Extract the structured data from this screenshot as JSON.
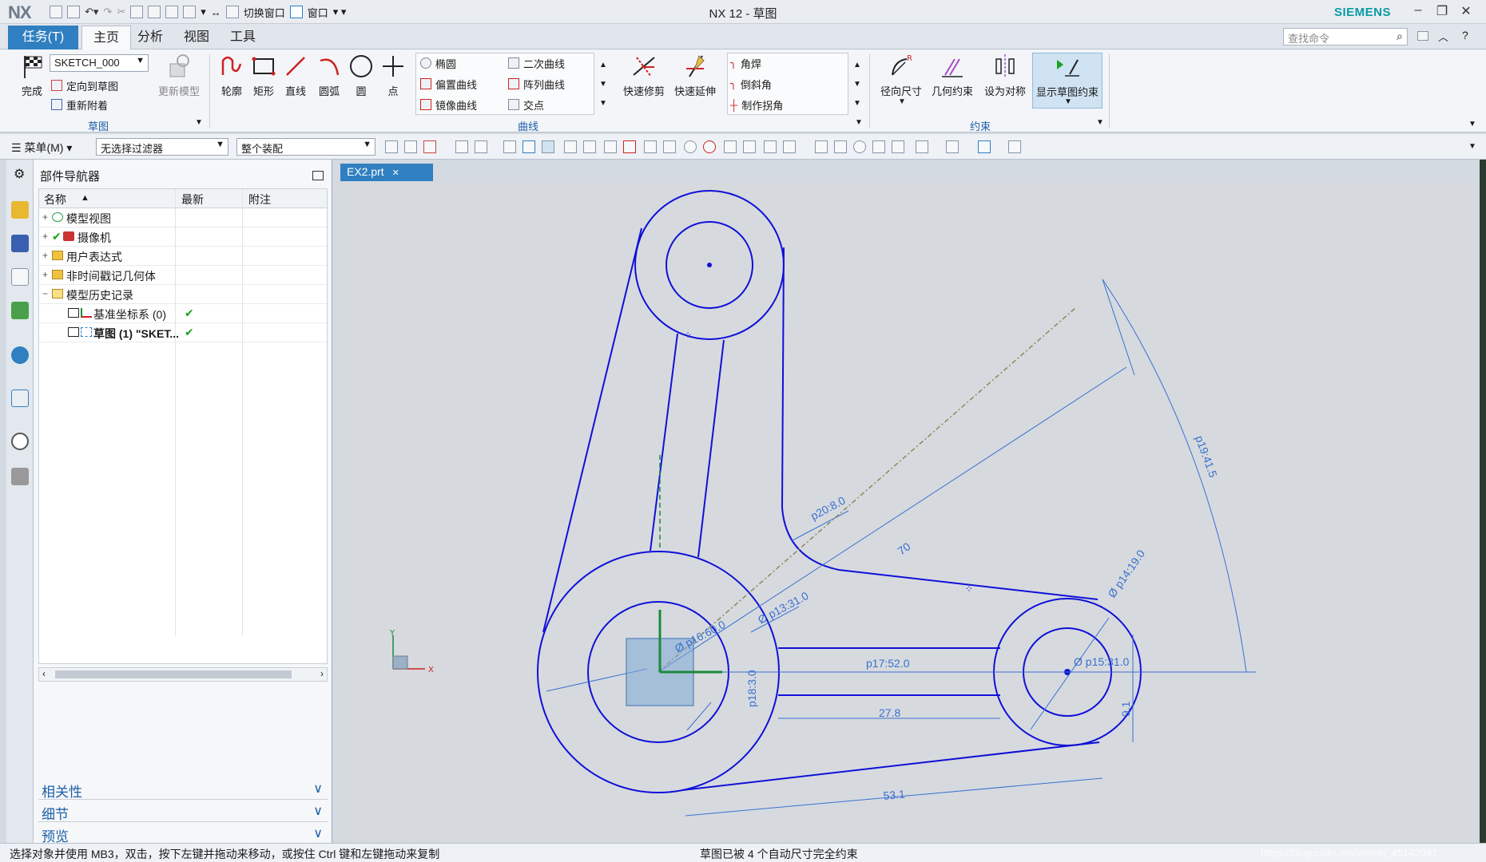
{
  "app": {
    "logo": "NX",
    "title": "NX 12 - 草图",
    "brand": "SIEMENS"
  },
  "quick_access": {
    "switch_window": "切换窗口",
    "window": "窗口"
  },
  "tabs": [
    {
      "label": "任务(T)"
    },
    {
      "label": "主页"
    },
    {
      "label": "分析"
    },
    {
      "label": "视图"
    },
    {
      "label": "工具"
    }
  ],
  "search": {
    "placeholder": "查找命令"
  },
  "ribbon": {
    "sketch": {
      "finish": "完成",
      "sketch_name": "SKETCH_000",
      "orient": "定向到草图",
      "reattach": "重新附着",
      "update_model": "更新模型",
      "group": "草图"
    },
    "curve": {
      "profile": "轮廓",
      "rect": "矩形",
      "line": "直线",
      "arc": "圆弧",
      "circle": "圆",
      "point": "点",
      "ellipse": "椭圆",
      "conic": "二次曲线",
      "offset": "偏置曲线",
      "pattern": "阵列曲线",
      "mirror": "镜像曲线",
      "intersect": "交点",
      "quick_trim": "快速修剪",
      "quick_extend": "快速延伸",
      "fillet": "角焊",
      "chamfer": "倒斜角",
      "make_corner": "制作拐角",
      "group": "曲线"
    },
    "constraint": {
      "radial_dim": "径向尺寸",
      "geo_constraint": "几何约束",
      "make_symmetric": "设为对称",
      "show_constraints": "显示草图约束",
      "group": "约束"
    }
  },
  "toolbar": {
    "menu": "菜单(M)",
    "filter": "无选择过滤器",
    "assembly": "整个装配"
  },
  "navigator": {
    "title": "部件导航器",
    "columns": {
      "name": "名称",
      "latest": "最新",
      "note": "附注"
    },
    "rows": [
      {
        "label": "模型视图",
        "exp": "+",
        "latest": ""
      },
      {
        "label": "摄像机",
        "exp": "+",
        "latest": ""
      },
      {
        "label": "用户表达式",
        "exp": "+",
        "latest": ""
      },
      {
        "label": "非时间戳记几何体",
        "exp": "+",
        "latest": ""
      },
      {
        "label": "模型历史记录",
        "exp": "−",
        "latest": ""
      },
      {
        "label": "基准坐标系 (0)",
        "exp": "",
        "latest": "✔"
      },
      {
        "label": "草图 (1) \"SKET...",
        "exp": "",
        "latest": "✔"
      }
    ],
    "panels": [
      "相关性",
      "细节",
      "预览"
    ]
  },
  "document_tab": {
    "label": "EX2.prt"
  },
  "sketch": {
    "line_color": "#1010d8",
    "dim_color": "#3a6fd1",
    "dims": {
      "p20": "p20:8.0",
      "p13": "Ø p13:31.0",
      "p16": "Ø p16:60.0",
      "p18": "p18:3.0",
      "p17": "p17:52.0",
      "d278": "27.8",
      "p15": "Ø p15:31.0",
      "p14": "Ø p14:19.0",
      "d91": "9.1",
      "d531": "53.1",
      "d70": "70",
      "p19": "p19:41.5"
    },
    "axes": {
      "x": "X",
      "y": "Y"
    }
  },
  "status": {
    "left": "选择对象并使用 MB3，双击，按下左键并拖动来移动，或按住 Ctrl 键和左键拖动来复制",
    "center": "草图已被 4 个自动尺寸完全约束",
    "watermark": "https://blog.csdn.net/weixin_45142091"
  }
}
